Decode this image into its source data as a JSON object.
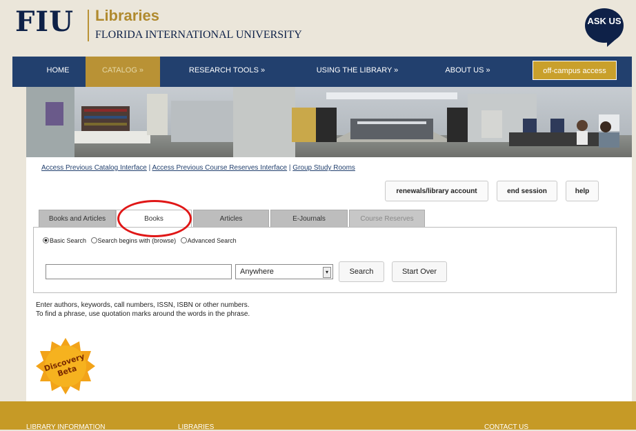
{
  "header": {
    "logo_text": "FIU",
    "libraries_label": "Libraries",
    "university_name": "FLORIDA INTERNATIONAL UNIVERSITY",
    "ask_us": "ASK US"
  },
  "nav": {
    "items": [
      {
        "label": "HOME"
      },
      {
        "label": "CATALOG »"
      },
      {
        "label": "RESEARCH TOOLS »"
      },
      {
        "label": "USING THE LIBRARY »"
      },
      {
        "label": "ABOUT US »"
      }
    ],
    "offcampus": "off-campus access"
  },
  "links": {
    "prev_catalog": "Access Previous Catalog Interface",
    "prev_reserves": "Access Previous Course Reserves Interface",
    "study_rooms": "Group Study Rooms",
    "sep": "|"
  },
  "page_buttons": {
    "renewals": "renewals/library account",
    "end_session": "end session",
    "help": "help"
  },
  "tabs": [
    "Books and Articles",
    "Books",
    "Articles",
    "E-Journals",
    "Course Reserves"
  ],
  "search": {
    "modes": [
      "Basic Search",
      "Search begins with (browse)",
      "Advanced Search"
    ],
    "input_value": "",
    "scope_selected": "Anywhere",
    "search_button": "Search",
    "start_over_button": "Start Over"
  },
  "help_text": {
    "line1": "Enter authors, keywords, call numbers, ISSN, ISBN or other numbers.",
    "line2": "To find a phrase, use quotation marks around the words in the phrase."
  },
  "badge": {
    "line1": "Discovery",
    "line2": "Beta"
  },
  "footer": {
    "col1": "LIBRARY INFORMATION",
    "col2": "LIBRARIES",
    "col3": "CONTACT US"
  },
  "colors": {
    "navy": "#22406e",
    "gold": "#b99235",
    "annotation_red": "#e01717"
  }
}
